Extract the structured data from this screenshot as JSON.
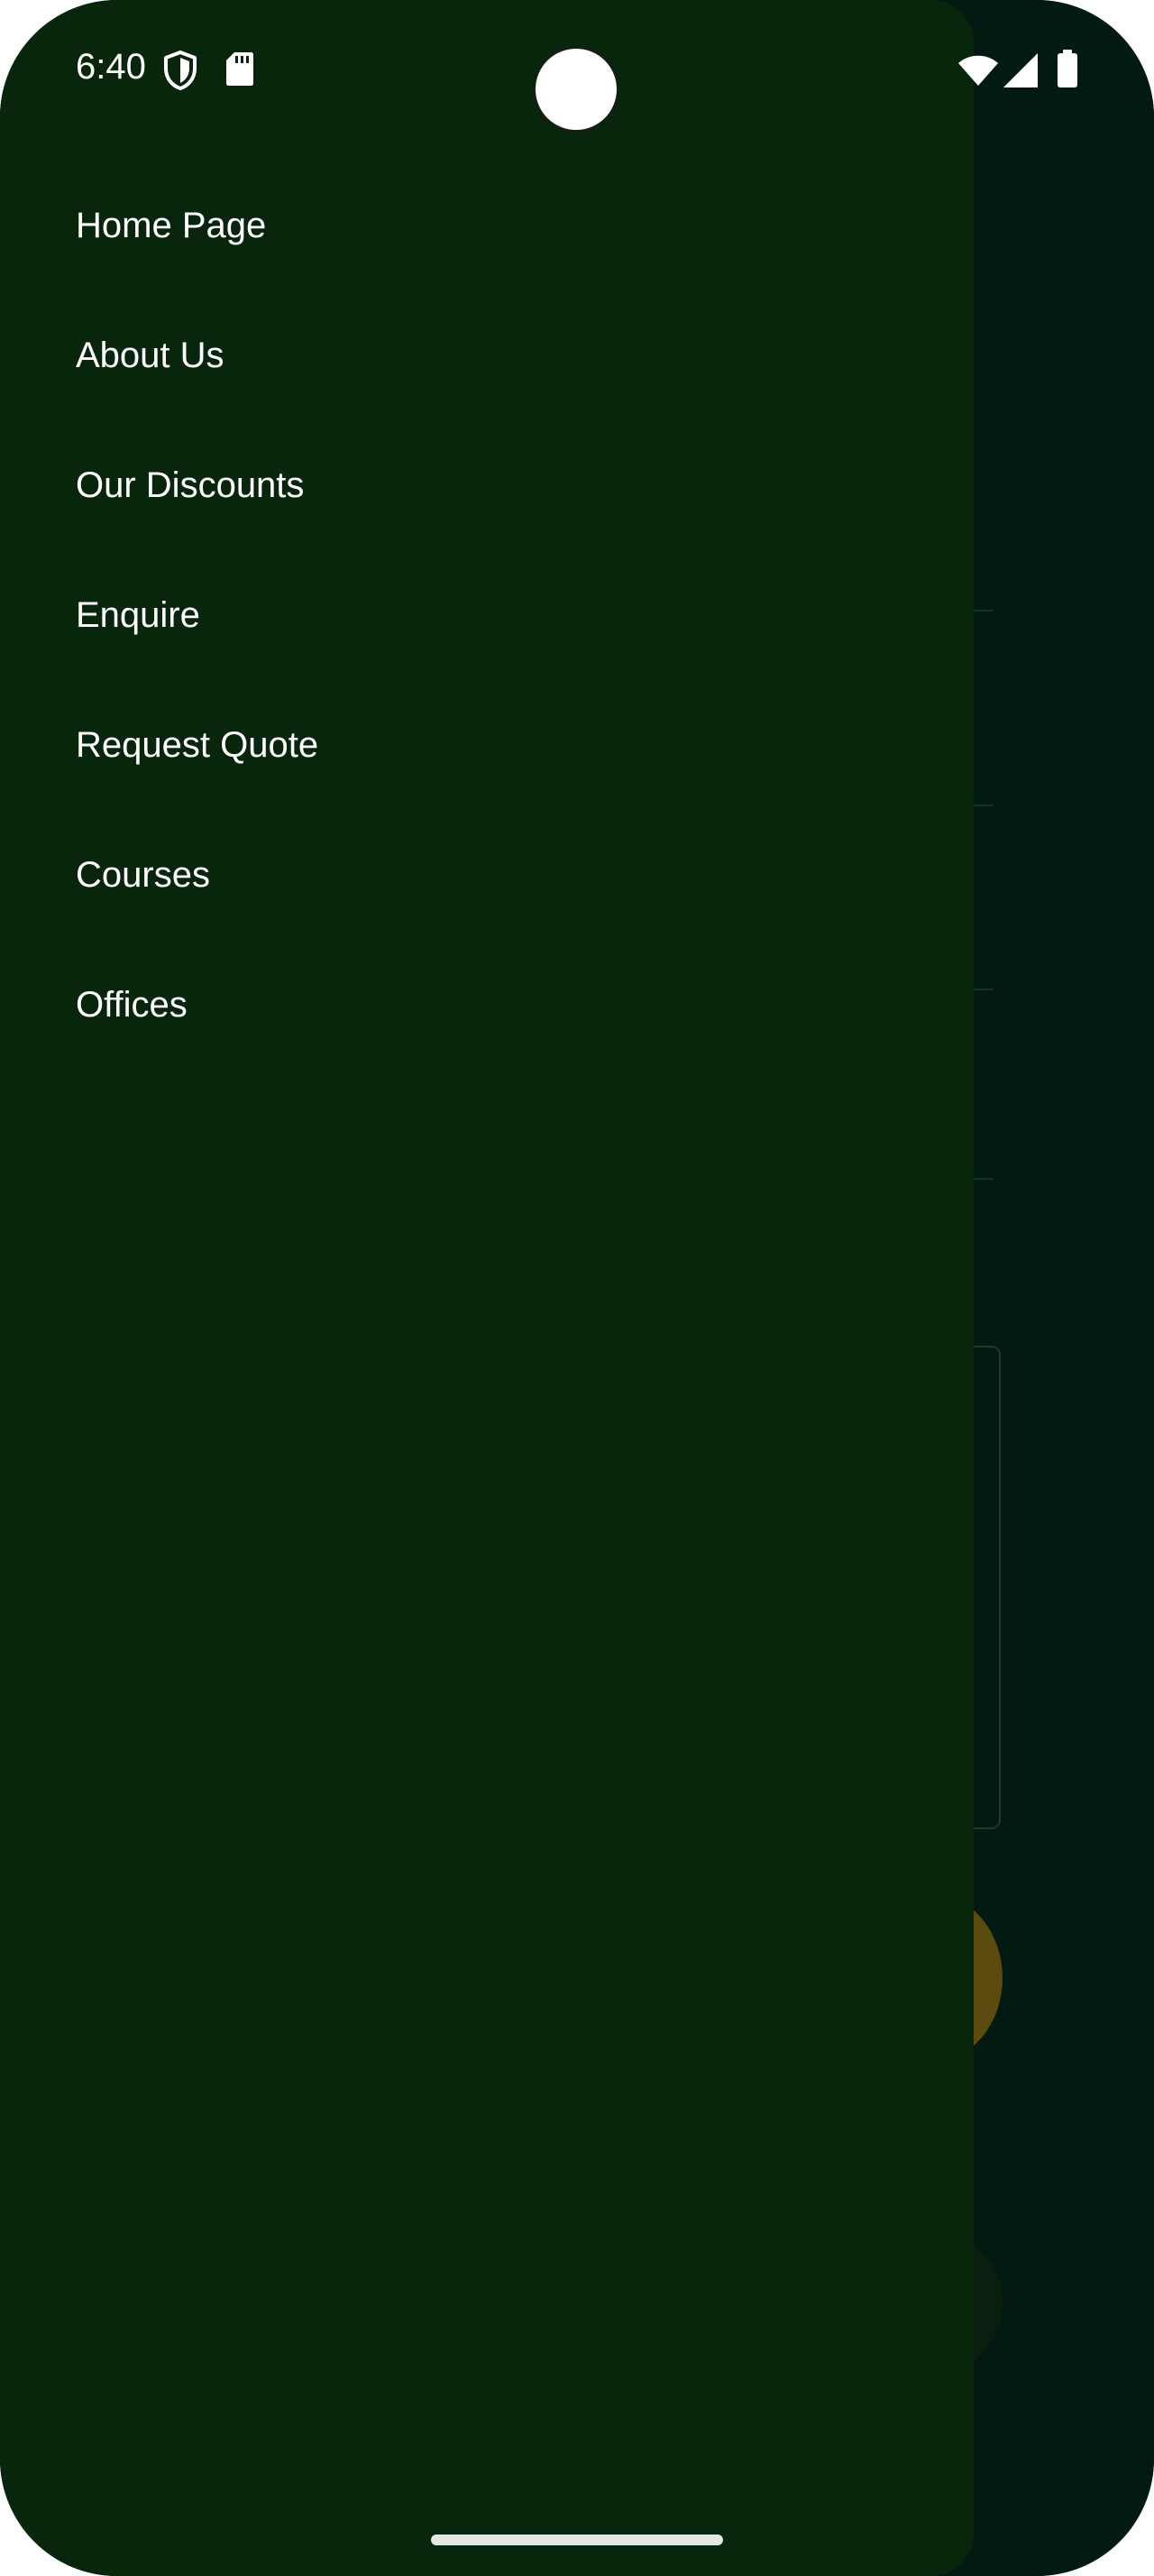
{
  "status_bar": {
    "time": "6:40",
    "icons": [
      "shield-icon",
      "sd-card-icon",
      "wifi-icon",
      "cell-signal-icon",
      "battery-icon"
    ]
  },
  "drawer": {
    "items": [
      {
        "label": "Home Page"
      },
      {
        "label": "About Us"
      },
      {
        "label": "Our Discounts"
      },
      {
        "label": "Enquire"
      },
      {
        "label": "Request Quote"
      },
      {
        "label": "Courses"
      },
      {
        "label": "Offices"
      }
    ]
  },
  "colors": {
    "drawer_background": "#08260b",
    "scrim_background": "#021a12",
    "menu_text": "#ffffff",
    "accent_fab": "#5b4b0f"
  }
}
